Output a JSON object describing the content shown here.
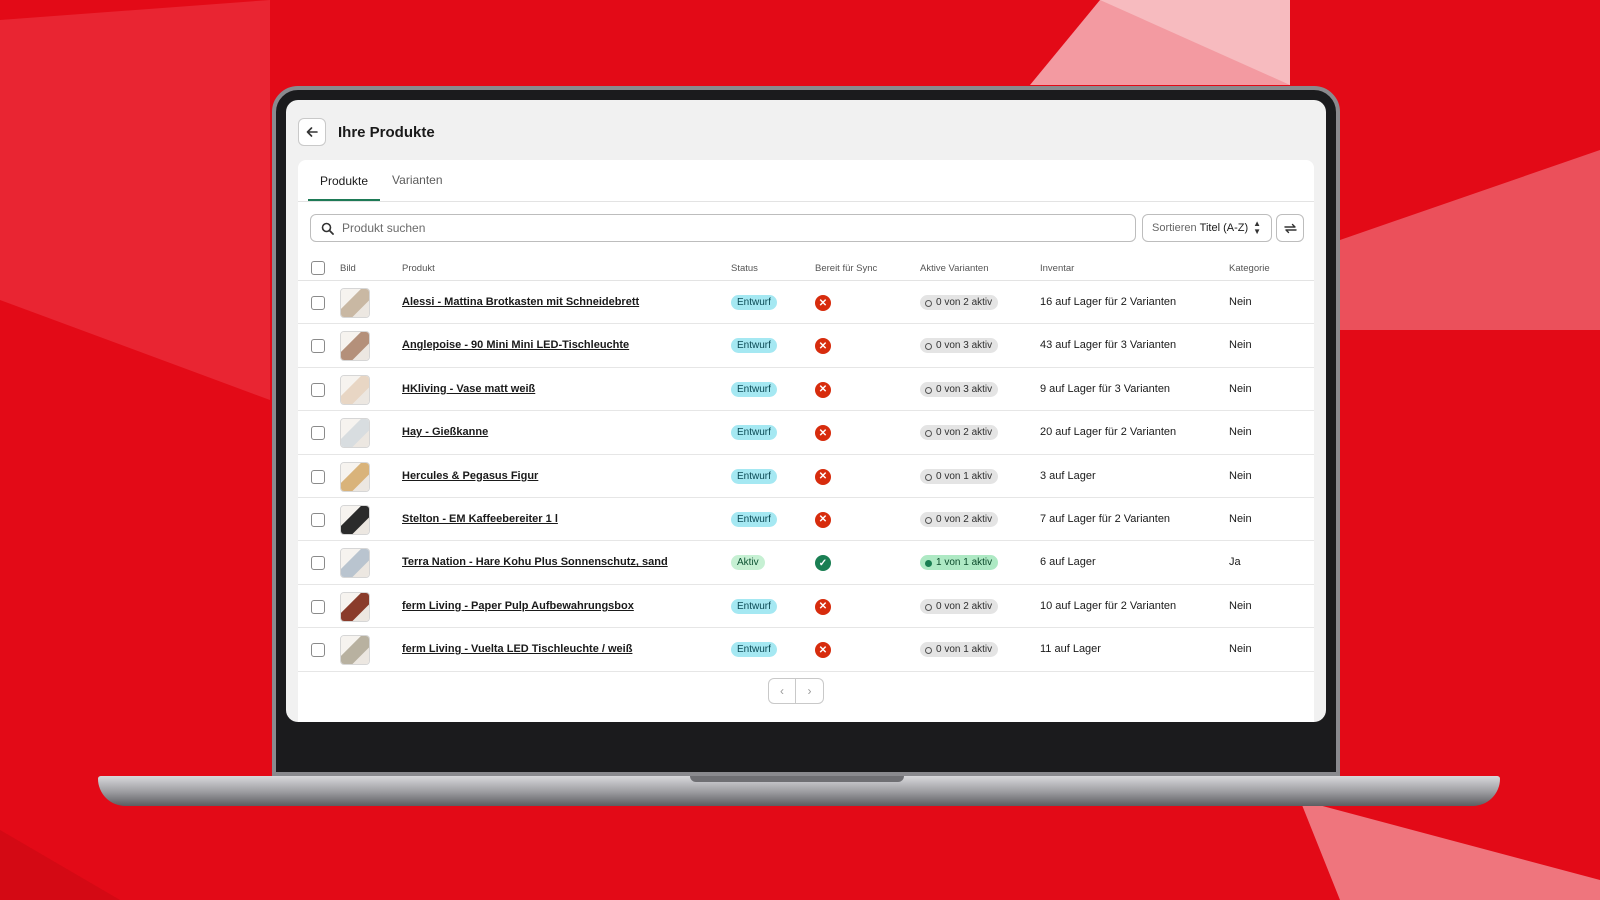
{
  "page": {
    "title": "Ihre Produkte"
  },
  "tabs": [
    {
      "label": "Produkte"
    },
    {
      "label": "Varianten"
    }
  ],
  "search": {
    "placeholder": "Produkt suchen",
    "value": ""
  },
  "sort": {
    "label": "Sortieren",
    "value": "Titel (A-Z)"
  },
  "table": {
    "headers": {
      "image": "Bild",
      "product": "Produkt",
      "status": "Status",
      "ready": "Bereit für Sync",
      "variants": "Aktive Varianten",
      "inventory": "Inventar",
      "category": "Kategorie"
    },
    "rows": [
      {
        "name": "Alessi - Mattina Brotkasten mit Schneidebrett",
        "status": "Entwurf",
        "ready": false,
        "variants": "0 von 2 aktiv",
        "inventory": "16 auf Lager für 2 Varianten",
        "category": "Nein"
      },
      {
        "name": "Anglepoise - 90 Mini Mini LED-Tischleuchte",
        "status": "Entwurf",
        "ready": false,
        "variants": "0 von 3 aktiv",
        "inventory": "43 auf Lager für 3 Varianten",
        "category": "Nein"
      },
      {
        "name": "HKliving - Vase matt weiß",
        "status": "Entwurf",
        "ready": false,
        "variants": "0 von 3 aktiv",
        "inventory": "9 auf Lager für 3 Varianten",
        "category": "Nein"
      },
      {
        "name": "Hay - Gießkanne",
        "status": "Entwurf",
        "ready": false,
        "variants": "0 von 2 aktiv",
        "inventory": "20 auf Lager für 2 Varianten",
        "category": "Nein"
      },
      {
        "name": "Hercules & Pegasus Figur",
        "status": "Entwurf",
        "ready": false,
        "variants": "0 von 1 aktiv",
        "inventory": "3 auf Lager",
        "category": "Nein"
      },
      {
        "name": "Stelton - EM Kaffeebereiter 1 l",
        "status": "Entwurf",
        "ready": false,
        "variants": "0 von 2 aktiv",
        "inventory": "7 auf Lager für 2 Varianten",
        "category": "Nein"
      },
      {
        "name": "Terra Nation - Hare Kohu Plus Sonnenschutz, sand",
        "status": "Aktiv",
        "ready": true,
        "variants": "1 von 1 aktiv",
        "inventory": "6 auf Lager",
        "category": "Ja"
      },
      {
        "name": "ferm Living - Paper Pulp Aufbewahrungsbox",
        "status": "Entwurf",
        "ready": false,
        "variants": "0 von 2 aktiv",
        "inventory": "10 auf Lager für 2 Varianten",
        "category": "Nein"
      },
      {
        "name": "ferm Living - Vuelta LED Tischleuchte / weiß",
        "status": "Entwurf",
        "ready": false,
        "variants": "0 von 1 aktiv",
        "inventory": "11 auf Lager",
        "category": "Nein"
      }
    ]
  },
  "colors": {
    "background": "#e30a17",
    "accent": "#1e7a56",
    "error": "#d72c0d",
    "success": "#1a7f53"
  },
  "icons": {
    "back": "arrow-left-icon",
    "search": "search-icon",
    "sync": "sync-icon",
    "not_ready": "x-circle-icon",
    "ready": "check-circle-icon",
    "prev": "chevron-left-icon",
    "next": "chevron-right-icon"
  }
}
